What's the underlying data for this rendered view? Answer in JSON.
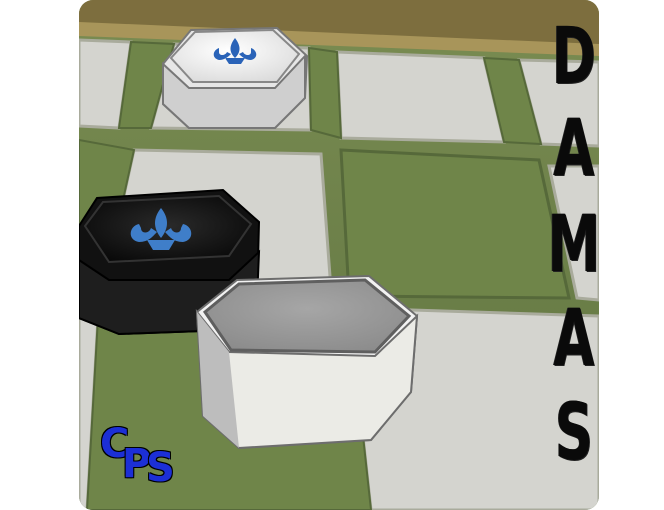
{
  "game": {
    "title_letters": [
      "D",
      "A",
      "M",
      "A",
      "S"
    ],
    "studio_logo": {
      "letters": [
        "C",
        "P",
        "S"
      ]
    },
    "board": {
      "light_square_color": "#d4d4cf",
      "dark_square_color": "#6f8549",
      "frame_color": "#8a7b4a"
    },
    "pieces": [
      {
        "color": "white",
        "crowned": true,
        "emblem": "fleur-de-lis-icon",
        "emblem_color": "#2a63b8"
      },
      {
        "color": "black",
        "crowned": true,
        "emblem": "fleur-de-lis-icon",
        "emblem_color": "#3f7ec9"
      },
      {
        "color": "white",
        "crowned": false
      }
    ],
    "accent_colors": {
      "title": "#0a0a0a",
      "logo": "#1c2fd6"
    }
  }
}
